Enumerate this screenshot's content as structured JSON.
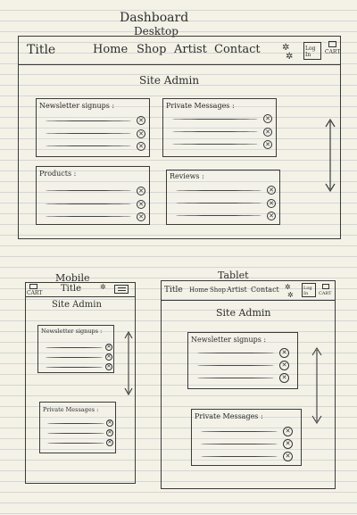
{
  "labels": {
    "dashboard": "Dashboard",
    "desktop": "Desktop",
    "mobile": "Mobile",
    "tablet": "Tablet"
  },
  "nav": {
    "title": "Title",
    "home": "Home",
    "shop": "Shop",
    "artist": "Artist",
    "contact": "Contact",
    "login": "Log In",
    "cart": "CART"
  },
  "page_heading": "Site Admin",
  "panels": {
    "newsletter": "Newsletter signups :",
    "private_messages": "Private Messages :",
    "products": "Products :",
    "reviews": "Reviews :"
  },
  "icons": [
    "gear-icon",
    "close-icon",
    "cart-icon",
    "menu-icon",
    "scroll-arrow-icon"
  ]
}
